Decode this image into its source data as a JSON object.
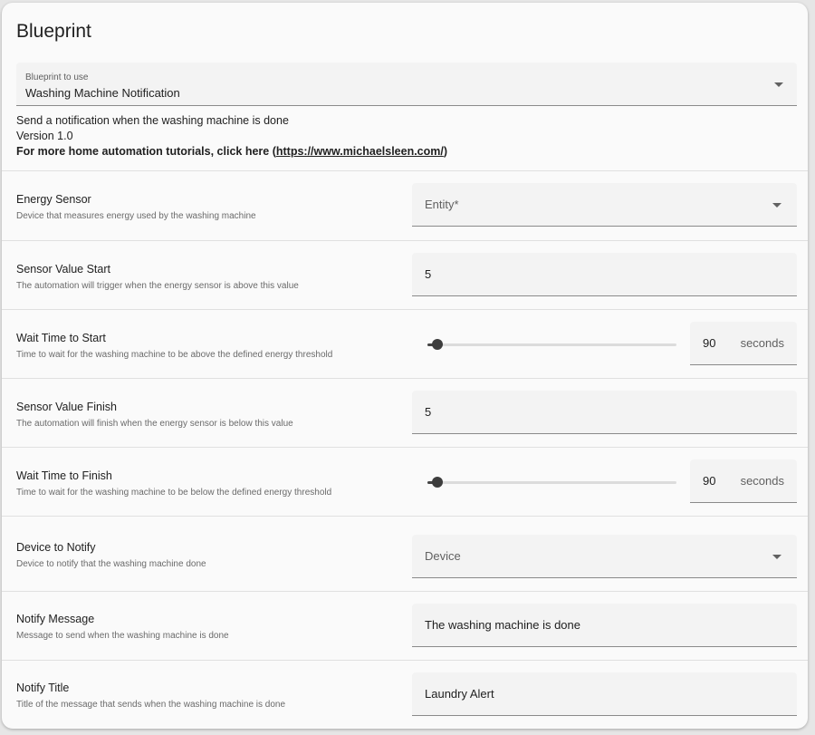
{
  "title": "Blueprint",
  "blueprint_select": {
    "label": "Blueprint to use",
    "value": "Washing Machine Notification"
  },
  "description": {
    "line1": "Send a notification when the washing machine is done",
    "line2": "Version 1.0",
    "line3_prefix": "For more home automation tutorials, click here (",
    "link": "https://www.michaelsleen.com/",
    "line3_suffix": ")"
  },
  "inputs": [
    {
      "name": "Energy Sensor",
      "help": "Device that measures energy used by the washing machine",
      "type": "select",
      "placeholder": "Entity*"
    },
    {
      "name": "Sensor Value Start",
      "help": "The automation will trigger when the energy sensor is above this value",
      "type": "text",
      "value": "5"
    },
    {
      "name": "Wait Time to Start",
      "help": "Time to wait for the washing machine to be above the defined energy threshold",
      "type": "slider",
      "value": "90",
      "unit": "seconds",
      "fraction": 0.03
    },
    {
      "name": "Sensor Value Finish",
      "help": "The automation will finish when the energy sensor is below this value",
      "type": "text",
      "value": "5"
    },
    {
      "name": "Wait Time to Finish",
      "help": "Time to wait for the washing machine to be below the defined energy threshold",
      "type": "slider",
      "value": "90",
      "unit": "seconds",
      "fraction": 0.03
    },
    {
      "name": "Device to Notify",
      "help": "Device to notify that the washing machine done",
      "type": "select",
      "placeholder": "Device"
    },
    {
      "name": "Notify Message",
      "help": "Message to send when the washing machine is done",
      "type": "text",
      "value": "The washing machine is done"
    },
    {
      "name": "Notify Title",
      "help": "Title of the message that sends when the washing machine is done",
      "type": "text",
      "value": "Laundry Alert"
    }
  ]
}
